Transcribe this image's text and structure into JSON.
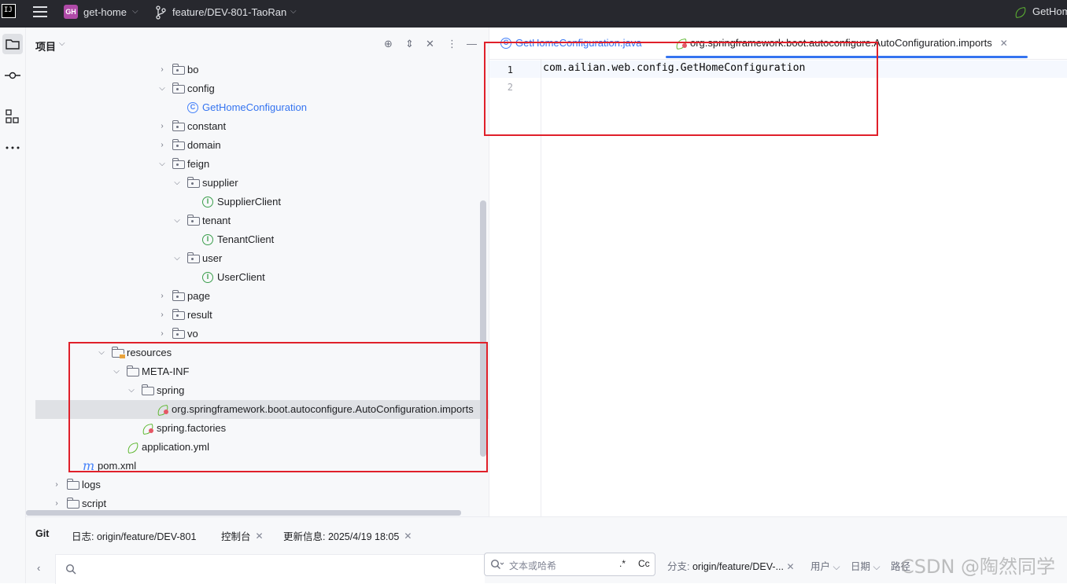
{
  "titlebar": {
    "app_icon": "intellij-logo",
    "project_badge": "GH",
    "project_name": "get-home",
    "branch": "feature/DEV-801-TaoRan",
    "right_label": "GetHom"
  },
  "left_toolbar": {
    "icons": [
      "folder-icon",
      "commit-icon",
      "structure-icon",
      "more-icon"
    ]
  },
  "project_panel": {
    "title": "项目",
    "tools": [
      "crosshair-icon",
      "expand-icon",
      "collapse-icon",
      "kebab-icon",
      "minimize-icon"
    ],
    "tree": [
      {
        "label": "bo",
        "type": "package",
        "expanded": false
      },
      {
        "label": "config",
        "type": "package",
        "expanded": true
      },
      {
        "label": "GetHomeConfiguration",
        "type": "class"
      },
      {
        "label": "constant",
        "type": "package",
        "expanded": false
      },
      {
        "label": "domain",
        "type": "package",
        "expanded": false
      },
      {
        "label": "feign",
        "type": "package",
        "expanded": true
      },
      {
        "label": "supplier",
        "type": "package",
        "expanded": true
      },
      {
        "label": "SupplierClient",
        "type": "interface"
      },
      {
        "label": "tenant",
        "type": "package",
        "expanded": true
      },
      {
        "label": "TenantClient",
        "type": "interface"
      },
      {
        "label": "user",
        "type": "package",
        "expanded": true
      },
      {
        "label": "UserClient",
        "type": "interface"
      },
      {
        "label": "page",
        "type": "package",
        "expanded": false
      },
      {
        "label": "result",
        "type": "package",
        "expanded": false
      },
      {
        "label": "vo",
        "type": "package",
        "expanded": false
      },
      {
        "label": "resources",
        "type": "resources-folder",
        "expanded": true
      },
      {
        "label": "META-INF",
        "type": "folder",
        "expanded": true
      },
      {
        "label": "spring",
        "type": "folder",
        "expanded": true
      },
      {
        "label": "org.springframework.boot.autoconfigure.AutoConfiguration.imports",
        "type": "spring-file",
        "selected": true
      },
      {
        "label": "spring.factories",
        "type": "spring-file"
      },
      {
        "label": "application.yml",
        "type": "spring-yml"
      },
      {
        "label": "pom.xml",
        "type": "maven"
      },
      {
        "label": "logs",
        "type": "folder",
        "expanded": false
      },
      {
        "label": "script",
        "type": "folder",
        "expanded": false
      }
    ]
  },
  "editor": {
    "tabs": [
      {
        "label": "GetHomeConfiguration.java",
        "active": false
      },
      {
        "label": "org.springframework.boot.autoconfigure.AutoConfiguration.imports",
        "active": true
      }
    ],
    "lines": [
      "1",
      "2"
    ],
    "code": "com.ailian.web.config.GetHomeConfiguration"
  },
  "git_panel": {
    "tabs": [
      {
        "label": "Git",
        "active": true
      },
      {
        "label": "日志: origin/feature/DEV-801"
      },
      {
        "label": "控制台"
      },
      {
        "label": "更新信息: 2025/4/19 18:05"
      }
    ],
    "search_placeholder": "文本或哈希",
    "regex_btn": ".*",
    "case_btn": "Cc",
    "filters": {
      "branch_label": "分支:",
      "branch_value": "origin/feature/DEV-...",
      "user": "用户",
      "date": "日期",
      "path": "路径"
    }
  },
  "watermark": "CSDN @陶然同学",
  "colors": {
    "accent": "#3574f0",
    "annotation_red": "#e0202a",
    "titlebar_bg": "#27282e",
    "panel_bg": "#f7f8fa"
  }
}
